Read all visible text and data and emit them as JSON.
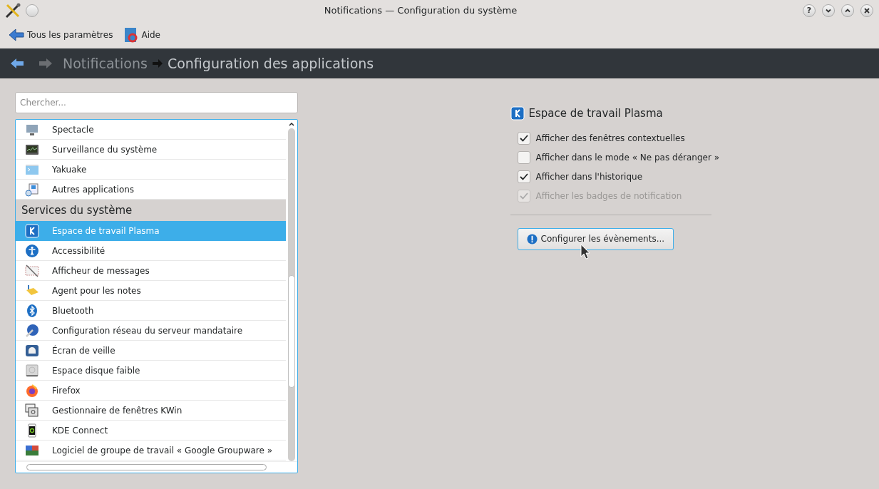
{
  "window": {
    "title": "Notifications — Configuration du système",
    "buttons": [
      {
        "kind": "help",
        "label": "?"
      },
      {
        "kind": "minimize"
      },
      {
        "kind": "maximize"
      },
      {
        "kind": "close"
      }
    ]
  },
  "toolbar": [
    {
      "kind": "back",
      "label": "Tous les paramètres"
    },
    {
      "kind": "help",
      "label": "Aide"
    }
  ],
  "breadcrumb": {
    "items": [
      "Notifications",
      "Configuration des applications"
    ]
  },
  "search": {
    "placeholder": "Chercher..."
  },
  "list": [
    {
      "kind": "item",
      "label": "Spectacle",
      "selected": false
    },
    {
      "kind": "item",
      "label": "Surveillance du système",
      "selected": false
    },
    {
      "kind": "item",
      "label": "Yakuake",
      "selected": false
    },
    {
      "kind": "item",
      "label": "Autres applications",
      "selected": false
    },
    {
      "kind": "header",
      "label": "Services du système"
    },
    {
      "kind": "item",
      "label": "Espace de travail Plasma",
      "selected": true
    },
    {
      "kind": "item",
      "label": "Accessibilité",
      "selected": false
    },
    {
      "kind": "item",
      "label": "Afficheur de messages",
      "selected": false
    },
    {
      "kind": "item",
      "label": "Agent pour les notes",
      "selected": false
    },
    {
      "kind": "item",
      "label": "Bluetooth",
      "selected": false
    },
    {
      "kind": "item",
      "label": "Configuration réseau du serveur mandataire",
      "selected": false
    },
    {
      "kind": "item",
      "label": "Écran de veille",
      "selected": false
    },
    {
      "kind": "item",
      "label": "Espace disque faible",
      "selected": false
    },
    {
      "kind": "item",
      "label": "Firefox",
      "selected": false
    },
    {
      "kind": "item",
      "label": "Gestionnaire de fenêtres KWin",
      "selected": false
    },
    {
      "kind": "item",
      "label": "KDE Connect",
      "selected": false
    },
    {
      "kind": "item",
      "label": "Logiciel de groupe de travail « Google Groupware »",
      "selected": false
    }
  ],
  "panel": {
    "title": "Espace de travail Plasma",
    "options": [
      {
        "label": "Afficher des fenêtres contextuelles",
        "checked": true,
        "disabled": false
      },
      {
        "label": "Afficher dans le mode « Ne pas déranger »",
        "checked": false,
        "disabled": false
      },
      {
        "label": "Afficher dans l'historique",
        "checked": true,
        "disabled": false
      },
      {
        "label": "Afficher les badges de notification",
        "checked": true,
        "disabled": true
      }
    ],
    "button": "Configurer les évènements..."
  }
}
